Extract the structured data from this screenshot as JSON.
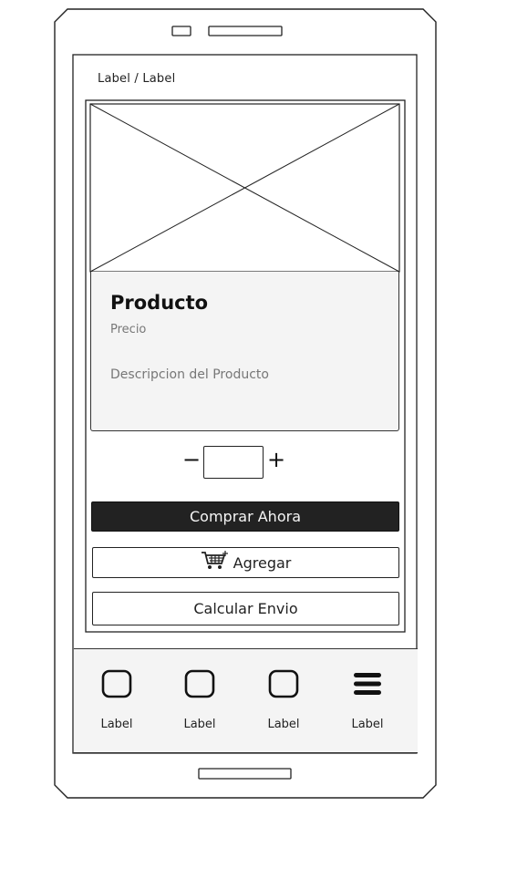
{
  "breadcrumb": "Label / Label",
  "product": {
    "image_icon": "image-placeholder-icon",
    "title": "Producto",
    "price": "Precio",
    "description": "Descripcion del Producto"
  },
  "quantity": {
    "minus": "−",
    "plus": "+",
    "value": ""
  },
  "actions": {
    "buy_label": "Comprar Ahora",
    "add_label": "Agregar",
    "add_icon": "cart-icon",
    "shipping_label": "Calcular Envio"
  },
  "bottom_nav": {
    "items": [
      {
        "icon": "square-icon",
        "label": "Label"
      },
      {
        "icon": "square-icon",
        "label": "Label"
      },
      {
        "icon": "square-icon",
        "label": "Label"
      },
      {
        "icon": "menu-icon",
        "label": "Label"
      }
    ]
  },
  "colors": {
    "dark_button": "#222222",
    "panel": "#f4f4f4",
    "muted_text": "#777777"
  }
}
